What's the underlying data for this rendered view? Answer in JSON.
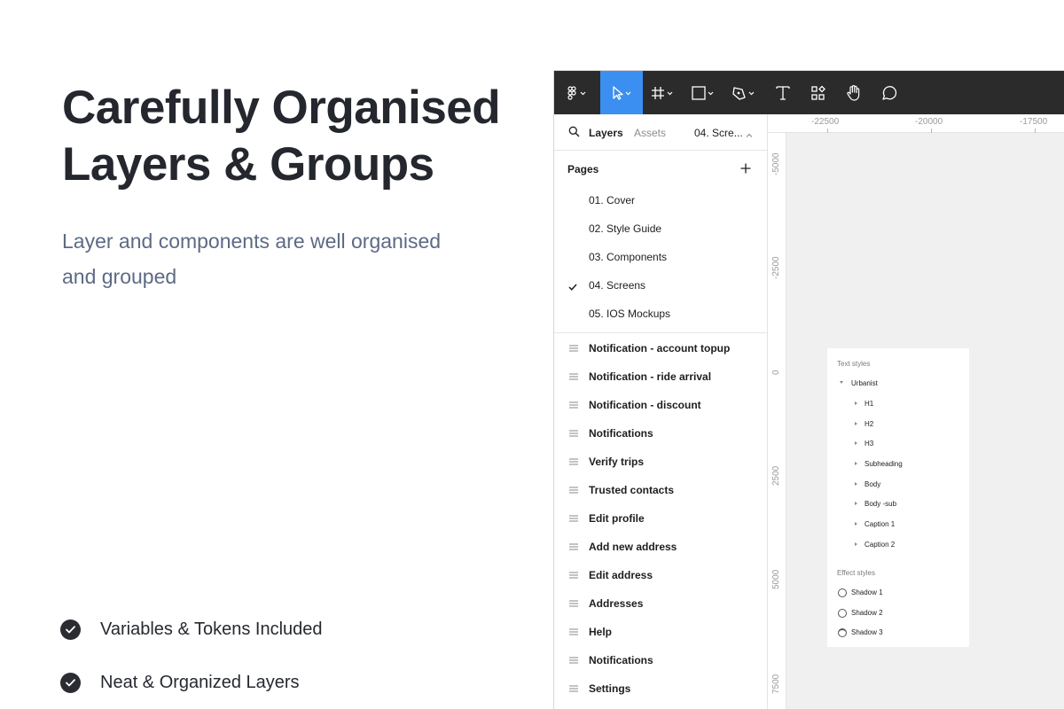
{
  "hero": {
    "title_line1": "Carefully Organised",
    "title_line2": "Layers & Groups",
    "subtitle_line1": "Layer and components are well organised",
    "subtitle_line2": "and grouped"
  },
  "features": [
    {
      "label": "Variables & Tokens Included"
    },
    {
      "label": "Neat & Organized Layers"
    }
  ],
  "toolbar": {
    "tools": [
      "figma-menu-icon",
      "move-tool-icon",
      "frame-tool-icon",
      "shape-tool-icon",
      "pen-tool-icon",
      "text-tool-icon",
      "components-icon",
      "hand-tool-icon",
      "comment-icon"
    ],
    "active_tool": "move-tool-icon",
    "active_color": "#3b8ff0",
    "background": "#2b2b2b"
  },
  "panel": {
    "tab_layers": "Layers",
    "tab_assets": "Assets",
    "current_page": "04. Scre...",
    "pages_title": "Pages",
    "pages": [
      {
        "name": "01. Cover",
        "selected": false
      },
      {
        "name": "02. Style Guide",
        "selected": false
      },
      {
        "name": "03. Components",
        "selected": false
      },
      {
        "name": "04. Screens",
        "selected": true
      },
      {
        "name": "05. IOS Mockups",
        "selected": false
      }
    ],
    "layers": [
      "Notification - account topup",
      "Notification - ride arrival",
      "Notification - discount",
      "Notifications",
      "Verify trips",
      "Trusted contacts",
      "Edit profile",
      "Add new address",
      "Edit address",
      "Addresses",
      "Help",
      "Notifications",
      "Settings"
    ]
  },
  "rulers": {
    "top": [
      "-22500",
      "-20000",
      "-17500"
    ],
    "left": [
      "-5000",
      "-2500",
      "0",
      "2500",
      "5000",
      "7500"
    ]
  },
  "style_card": {
    "text_styles_title": "Text styles",
    "font_group": "Urbanist",
    "text_styles": [
      "H1",
      "H2",
      "H3",
      "Subheading",
      "Body",
      "Body -sub",
      "Caption 1",
      "Caption 2"
    ],
    "effect_styles_title": "Effect styles",
    "effect_styles": [
      "Shadow 1",
      "Shadow 2",
      "Shadow 3"
    ]
  }
}
